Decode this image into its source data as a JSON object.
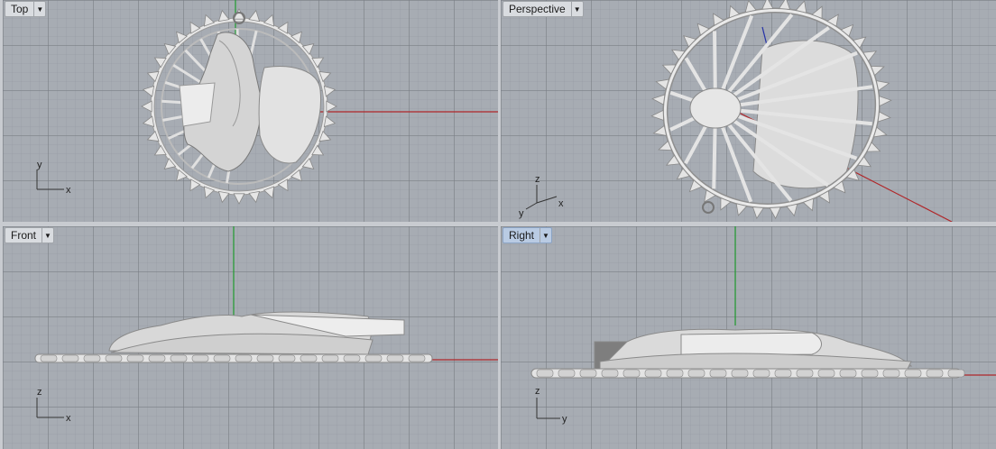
{
  "viewports": {
    "top": {
      "label": "Top",
      "axes": [
        "x",
        "y"
      ]
    },
    "persp": {
      "label": "Perspective",
      "axes": [
        "x",
        "y",
        "z"
      ]
    },
    "front": {
      "label": "Front",
      "axes": [
        "x",
        "z"
      ]
    },
    "right": {
      "label": "Right",
      "axes": [
        "y",
        "z"
      ]
    }
  },
  "active_viewport": "Right",
  "colors": {
    "x_axis": "#b0272a",
    "y_axis": "#1f9a2e",
    "z_axis": "#2633a8",
    "model": "#e6e6e6",
    "model_edge": "#8a8a8a"
  },
  "icons": {
    "tab_menu": "dropdown-arrow-icon"
  }
}
